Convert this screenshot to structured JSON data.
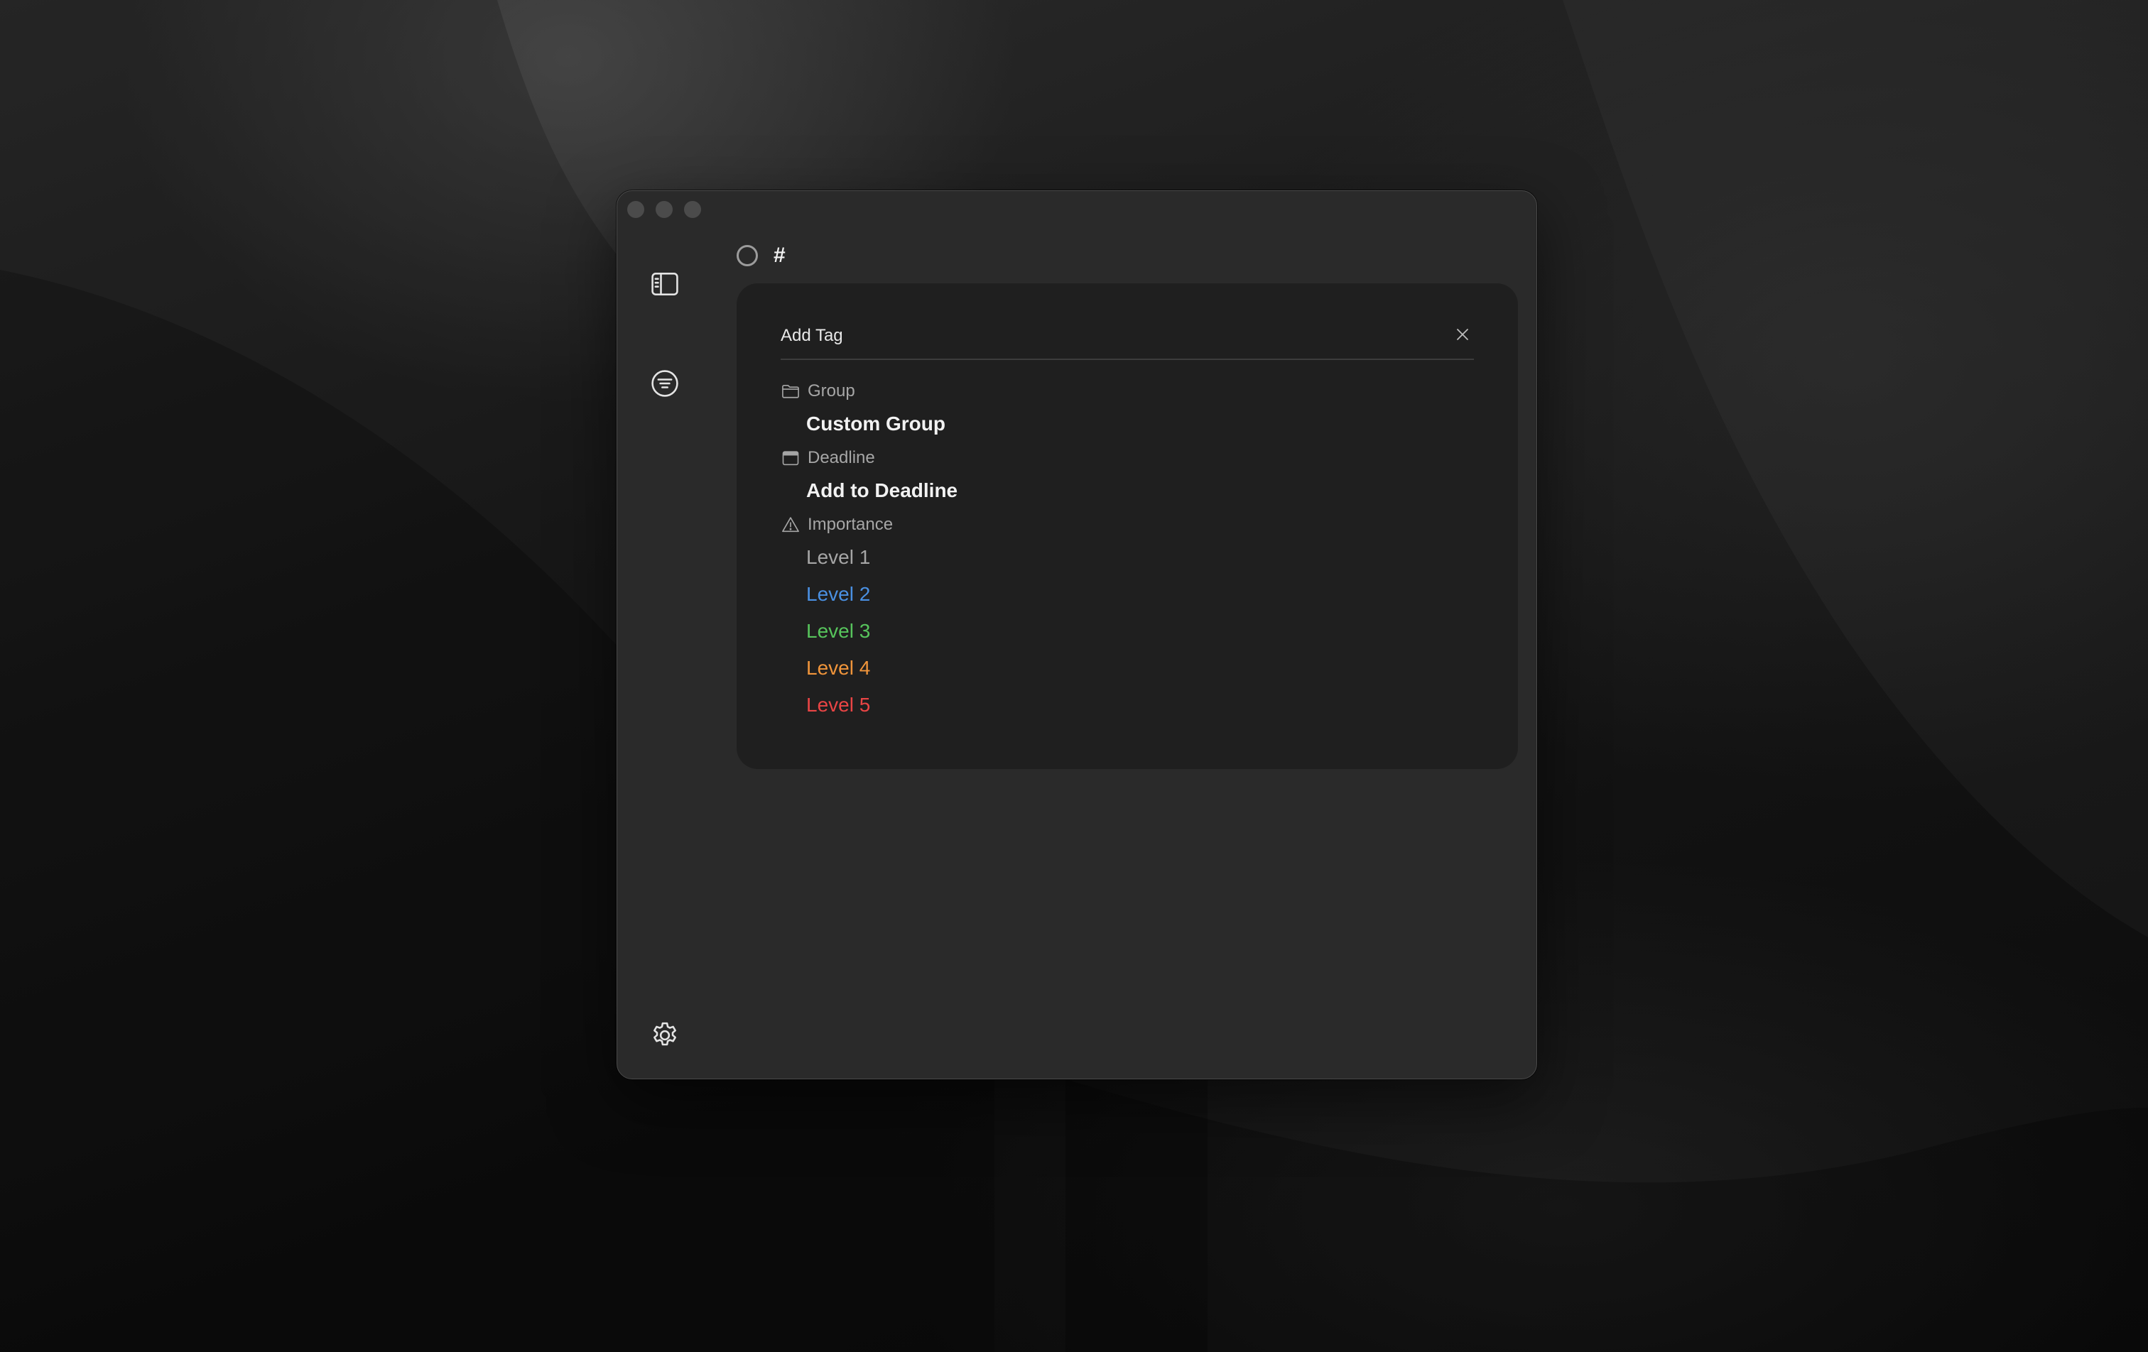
{
  "task": {
    "text": "#"
  },
  "popover": {
    "title": "Add Tag",
    "sections": {
      "group": {
        "label": "Group",
        "option": "Custom Group"
      },
      "deadline": {
        "label": "Deadline",
        "option": "Add to Deadline"
      },
      "importance": {
        "label": "Importance",
        "levels": [
          {
            "label": "Level 1",
            "color": "#a6a6a6"
          },
          {
            "label": "Level 2",
            "color": "#4a90e2"
          },
          {
            "label": "Level 3",
            "color": "#57c45c"
          },
          {
            "label": "Level 4",
            "color": "#f0953b"
          },
          {
            "label": "Level 5",
            "color": "#ea4545"
          }
        ]
      }
    }
  },
  "icons": {
    "sidebar_toggle": "sidebar-icon",
    "filter": "filter-icon",
    "settings": "gear-icon",
    "close": "close-icon",
    "group": "folder-icon",
    "deadline": "calendar-icon",
    "importance": "warning-icon"
  },
  "colors": {
    "window_bg": "#2a2a2a",
    "popover_bg": "#1f1f1f",
    "text_primary": "#f2f2f2",
    "text_secondary": "#a6a6a6"
  }
}
